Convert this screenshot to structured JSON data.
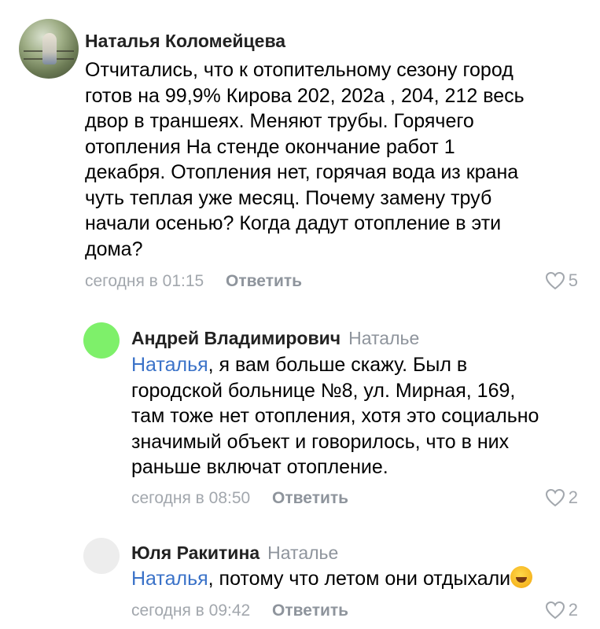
{
  "comments": [
    {
      "author": "Наталья Коломейцева",
      "reply_to": "",
      "mention": "",
      "lines": [
        "Отчитались, что к отопительному сезону город",
        "готов на 99,9% Кирова 202, 202а , 204, 212 весь",
        "двор в траншеях. Меняют трубы. Горячего",
        "отопления На стенде окончание  работ  1",
        "декабря. Отопления нет, горячая вода из крана",
        "чуть теплая уже месяц. Почему замену труб",
        "начали осенью? Когда дадут отопление в эти",
        "дома?"
      ],
      "time": "сегодня в 01:15",
      "reply_label": "Ответить",
      "likes": "5",
      "avatar": "photo"
    },
    {
      "author": "Андрей Владимирович",
      "reply_to": "Наталье",
      "mention": "Наталья",
      "lines": [
        ", я вам больше скажу. Был в",
        "городской больнице №8, ул. Мирная, 169,",
        "там тоже нет отопления, хотя это социально",
        "значимый объект и говорилось, что в них",
        "раньше включат отопление."
      ],
      "time": "сегодня в 08:50",
      "reply_label": "Ответить",
      "likes": "2",
      "avatar_color": "#7ef06a"
    },
    {
      "author": "Юля Ракитина",
      "reply_to": "Наталье",
      "mention": "Наталья",
      "lines": [
        ", потому что летом они отдыхали"
      ],
      "emoji": "rolling-on-floor-laughing",
      "time": "сегодня в 09:42",
      "reply_label": "Ответить",
      "likes": "2",
      "avatar_color": "#ededed"
    }
  ],
  "colors": {
    "link": "#3a72c8",
    "meta": "#a2a7ad",
    "reply_button": "#8e949c"
  }
}
